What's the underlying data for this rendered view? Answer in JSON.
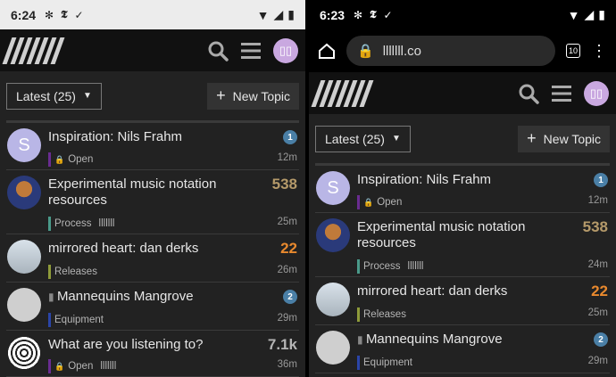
{
  "left": {
    "status_time": "6:24",
    "header_logo": "///////",
    "sort_label": "Latest (25)",
    "new_topic_label": "New Topic",
    "topics": [
      {
        "title": "Inspiration: Nils Frahm",
        "category": "Open",
        "lock": true,
        "tag": "",
        "count": "1",
        "count_type": "badge",
        "time": "12m",
        "avatar": "S",
        "cat_color": "#6a2c91"
      },
      {
        "title": "Experimental music notation resources",
        "category": "Process",
        "lock": false,
        "tag": "lllllll",
        "count": "538",
        "count_type": "heat-low",
        "time": "25m",
        "avatar": "",
        "cat_color": "#4a9a8a"
      },
      {
        "title": "mirrored heart: dan derks",
        "category": "Releases",
        "lock": false,
        "tag": "",
        "count": "22",
        "count_type": "heat-high",
        "time": "26m",
        "avatar": "",
        "cat_color": "#8e9b3a"
      },
      {
        "title": "Mannequins Mangrove",
        "category": "Equipment",
        "lock": false,
        "tag": "",
        "count": "2",
        "count_type": "badge",
        "time": "29m",
        "avatar": "",
        "cat_color": "#2b45a8",
        "bookmark": true
      },
      {
        "title": "What are you listening to?",
        "category": "Open",
        "lock": true,
        "tag": "lllllll",
        "count": "7.1k",
        "count_type": "plain",
        "time": "36m",
        "avatar": "",
        "cat_color": "#6a2c91"
      }
    ]
  },
  "right": {
    "status_time": "6:23",
    "url": "lllllll.co",
    "tab_count": "10",
    "header_logo": "///////",
    "sort_label": "Latest (25)",
    "new_topic_label": "New Topic",
    "topics": [
      {
        "title": "Inspiration: Nils Frahm",
        "category": "Open",
        "lock": true,
        "tag": "",
        "count": "1",
        "count_type": "badge",
        "time": "12m",
        "avatar": "S",
        "cat_color": "#6a2c91"
      },
      {
        "title": "Experimental music notation resources",
        "category": "Process",
        "lock": false,
        "tag": "lllllll",
        "count": "538",
        "count_type": "heat-low",
        "time": "24m",
        "avatar": "",
        "cat_color": "#4a9a8a"
      },
      {
        "title": "mirrored heart: dan derks",
        "category": "Releases",
        "lock": false,
        "tag": "",
        "count": "22",
        "count_type": "heat-high",
        "time": "25m",
        "avatar": "",
        "cat_color": "#8e9b3a"
      },
      {
        "title": "Mannequins Mangrove",
        "category": "Equipment",
        "lock": false,
        "tag": "",
        "count": "2",
        "count_type": "badge",
        "time": "29m",
        "avatar": "",
        "cat_color": "#2b45a8",
        "bookmark": true
      }
    ]
  },
  "colors": {
    "badge": "#4a7fa6",
    "heat_low": "#b59a6a",
    "heat_high": "#e8892e",
    "plain_count": "#b5b5b5"
  }
}
